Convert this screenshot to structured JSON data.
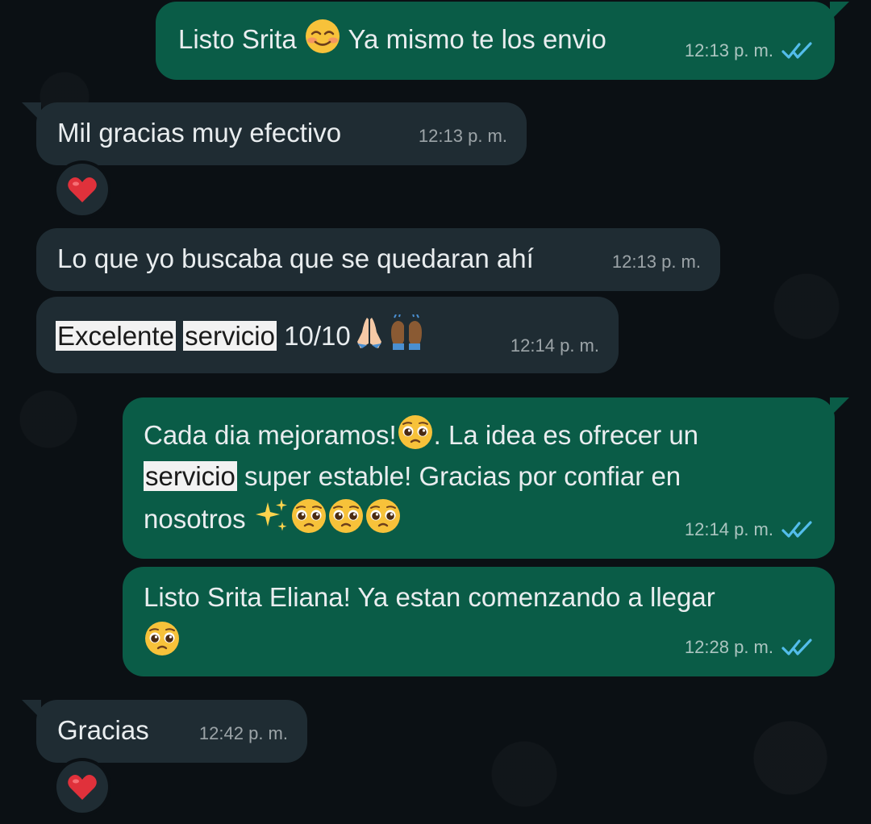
{
  "messages": [
    {
      "dir": "out",
      "text_a": "Listo Srita",
      "emoji": "smiling-face-with-smiling-eyes",
      "text_b": "Ya mismo te los envio",
      "time": "12:13 p. m.",
      "status": "read-double-check"
    },
    {
      "dir": "in",
      "text": "Mil gracias muy efectivo",
      "time": "12:13 p. m.",
      "reaction": "red-heart"
    },
    {
      "dir": "in",
      "text": "Lo que yo buscaba que se quedaran ahí",
      "time": "12:13 p. m."
    },
    {
      "dir": "in",
      "word1": "Excelente",
      "word2": "servicio",
      "text_c": "10/10",
      "emojis": [
        "folded-hands",
        "raising-hands"
      ],
      "time": "12:14 p. m."
    },
    {
      "dir": "out",
      "line1_a": "Cada dia mejoramos!",
      "line1_b": ". La idea es ofrecer un",
      "line2_hl": "servicio",
      "line2_b": "super estable! Gracias por confiar en",
      "line3": "nosotros",
      "emojis": [
        "sparkles",
        "pleading-face",
        "pleading-face",
        "pleading-face"
      ],
      "time": "12:14 p. m.",
      "status": "read-double-check"
    },
    {
      "dir": "out",
      "text": "Listo Srita Eliana! Ya estan comenzando a llegar",
      "emoji": "pleading-face",
      "time": "12:28 p. m.",
      "status": "read-double-check"
    },
    {
      "dir": "in",
      "text": "Gracias",
      "time": "12:42 p. m.",
      "reaction": "red-heart"
    }
  ],
  "colors": {
    "background": "#0b1014",
    "outgoing_bubble": "#0a5c47",
    "incoming_bubble": "#1f2c33",
    "read_ticks": "#53bdeb",
    "text": "#e9edef"
  }
}
